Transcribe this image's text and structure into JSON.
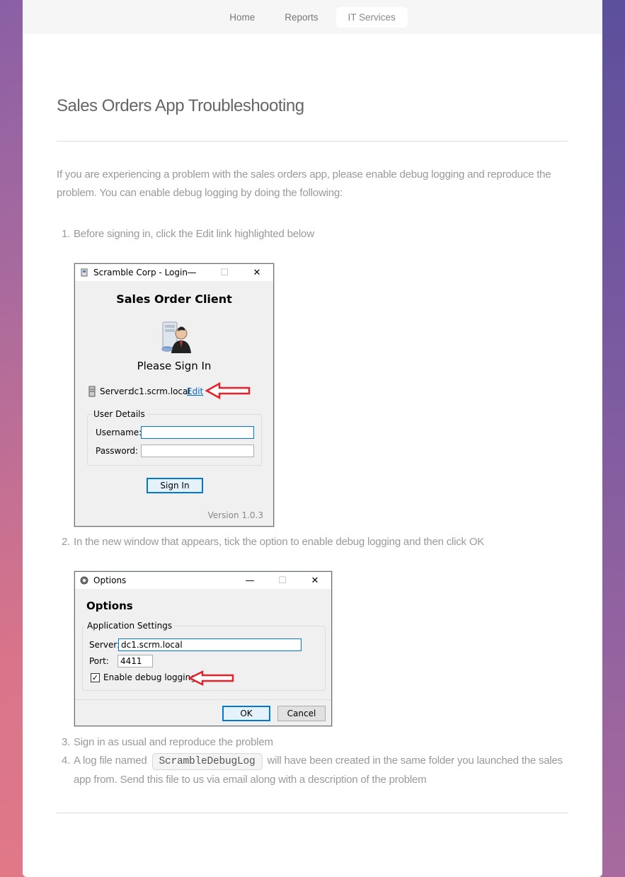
{
  "nav": {
    "items": [
      {
        "label": "Home"
      },
      {
        "label": "Reports"
      },
      {
        "label": "IT Services"
      }
    ]
  },
  "page": {
    "title": "Sales Orders App Troubleshooting",
    "intro": "If you are experiencing a problem with the sales orders app, please enable debug logging and reproduce the problem. You can enable debug logging by doing the following:",
    "steps": [
      {
        "num": "1.",
        "text": "Before signing in, click the Edit link highlighted below"
      },
      {
        "num": "2.",
        "text": "In the new window that appears, tick the option to enable debug logging and then click OK"
      },
      {
        "num": "3.",
        "text": "Sign in as usual and reproduce the problem"
      },
      {
        "num": "4.",
        "text_before": "A log file named",
        "code": "ScrambleDebugLog",
        "text_after": "will have been created in the same folder you launched the sales app from. Send this file to us via email along with a description of the problem"
      }
    ]
  },
  "login_dialog": {
    "title": "Scramble Corp - Login",
    "heading": "Sales Order Client",
    "subheading": "Please Sign In",
    "server_label": "Server:",
    "server_value": "dc1.scrm.local",
    "edit_link": "Edit",
    "group_title": "User Details",
    "username_label": "Username:",
    "password_label": "Password:",
    "username_value": "",
    "password_value": "",
    "sign_in_button": "Sign In",
    "version": "Version 1.0.3"
  },
  "options_dialog": {
    "title": "Options",
    "heading": "Options",
    "group_title": "Application Settings",
    "server_label": "Server:",
    "server_value": "dc1.scrm.local",
    "port_label": "Port:",
    "port_value": "4411",
    "debug_label": "Enable debug logging",
    "debug_checked": true,
    "ok_button": "OK",
    "cancel_button": "Cancel"
  },
  "titlebar_controls": {
    "minimize": "—",
    "maximize": "☐",
    "close": "✕"
  },
  "colors": {
    "highlight_arrow": "#e8202a",
    "link": "#0066cc",
    "focus_border": "#0078d7"
  }
}
